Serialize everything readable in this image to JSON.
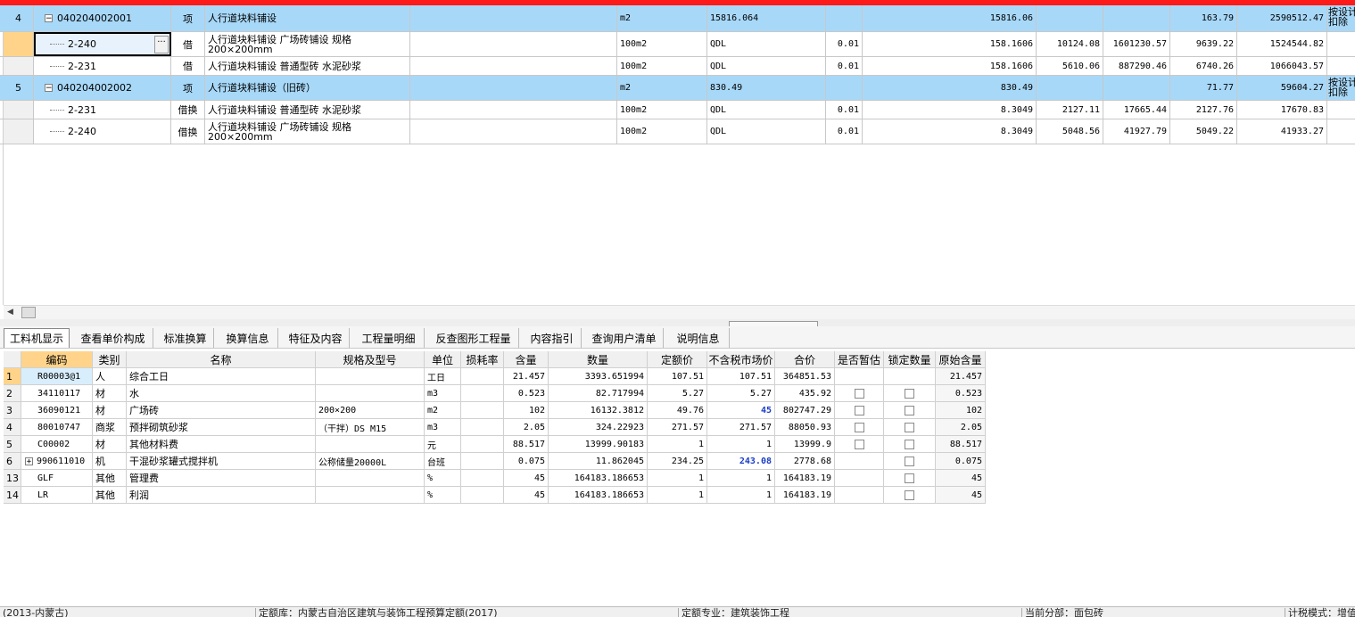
{
  "top_grid": {
    "rows": [
      {
        "num": "4",
        "code": "040204002001",
        "type": "项",
        "name": "人行道块料铺设",
        "unit": "m2",
        "qty_expr": "15816.064",
        "coef": "",
        "qty": "15816.06",
        "c1": "",
        "c2": "",
        "price": "163.79",
        "total": "2590512.47",
        "note": "按设计\n扣除"
      },
      {
        "num": "",
        "code": "2-240",
        "type": "借",
        "name": "人行道块料铺设 广场砖铺设 规格200×200mm",
        "unit": "100m2",
        "qty_expr": "QDL",
        "coef": "0.01",
        "qty": "158.1606",
        "c1": "10124.08",
        "c2": "1601230.57",
        "price": "9639.22",
        "total": "1524544.82",
        "note": ""
      },
      {
        "num": "",
        "code": "2-231",
        "type": "借",
        "name": "人行道块料铺设 普通型砖 水泥砂浆",
        "unit": "100m2",
        "qty_expr": "QDL",
        "coef": "0.01",
        "qty": "158.1606",
        "c1": "5610.06",
        "c2": "887290.46",
        "price": "6740.26",
        "total": "1066043.57",
        "note": ""
      },
      {
        "num": "5",
        "code": "040204002002",
        "type": "项",
        "name": "人行道块料铺设（旧砖）",
        "unit": "m2",
        "qty_expr": "830.49",
        "coef": "",
        "qty": "830.49",
        "c1": "",
        "c2": "",
        "price": "71.77",
        "total": "59604.27",
        "note": "按设计\n扣除"
      },
      {
        "num": "",
        "code": "2-231",
        "type": "借换",
        "name": "人行道块料铺设 普通型砖 水泥砂浆",
        "unit": "100m2",
        "qty_expr": "QDL",
        "coef": "0.01",
        "qty": "8.3049",
        "c1": "2127.11",
        "c2": "17665.44",
        "price": "2127.76",
        "total": "17670.83",
        "note": ""
      },
      {
        "num": "",
        "code": "2-240",
        "type": "借换",
        "name": "人行道块料铺设 广场砖铺设 规格200×200mm",
        "unit": "100m2",
        "qty_expr": "QDL",
        "coef": "0.01",
        "qty": "8.3049",
        "c1": "5048.56",
        "c2": "41927.79",
        "price": "5049.22",
        "total": "41933.27",
        "note": ""
      }
    ]
  },
  "tabs": [
    "工料机显示",
    "查看单价构成",
    "标准换算",
    "换算信息",
    "特征及内容",
    "工程量明细",
    "反查图形工程量",
    "内容指引",
    "查询用户清单",
    "说明信息"
  ],
  "lower_grid": {
    "headers": [
      "编码",
      "类别",
      "名称",
      "规格及型号",
      "单位",
      "损耗率",
      "含量",
      "数量",
      "定额价",
      "不含税市场价",
      "合价",
      "是否暂估",
      "锁定数量",
      "原始含量"
    ],
    "rows": [
      {
        "rn": "1",
        "code": "R00003@1",
        "cat": "人",
        "name": "综合工日",
        "spec": "",
        "unit": "工日",
        "loss": "",
        "content": "21.457",
        "qty": "3393.651994",
        "base": "107.51",
        "market": "107.51",
        "total": "364851.53",
        "est": false,
        "lock": false,
        "orig": "21.457",
        "blue": false,
        "plus": false
      },
      {
        "rn": "2",
        "code": "34110117",
        "cat": "材",
        "name": "水",
        "spec": "",
        "unit": "m3",
        "loss": "",
        "content": "0.523",
        "qty": "82.717994",
        "base": "5.27",
        "market": "5.27",
        "total": "435.92",
        "est": true,
        "lock": true,
        "orig": "0.523",
        "blue": false,
        "plus": false
      },
      {
        "rn": "3",
        "code": "36090121",
        "cat": "材",
        "name": "广场砖",
        "spec": "200×200",
        "unit": "m2",
        "loss": "",
        "content": "102",
        "qty": "16132.3812",
        "base": "49.76",
        "market": "45",
        "total": "802747.29",
        "est": true,
        "lock": true,
        "orig": "102",
        "blue": true,
        "plus": false
      },
      {
        "rn": "4",
        "code": "80010747",
        "cat": "商浆",
        "name": "预拌砌筑砂浆",
        "spec": "（干拌）DS M15",
        "unit": "m3",
        "loss": "",
        "content": "2.05",
        "qty": "324.22923",
        "base": "271.57",
        "market": "271.57",
        "total": "88050.93",
        "est": true,
        "lock": true,
        "orig": "2.05",
        "blue": false,
        "plus": false
      },
      {
        "rn": "5",
        "code": "C00002",
        "cat": "材",
        "name": "其他材料费",
        "spec": "",
        "unit": "元",
        "loss": "",
        "content": "88.517",
        "qty": "13999.90183",
        "base": "1",
        "market": "1",
        "total": "13999.9",
        "est": true,
        "lock": true,
        "orig": "88.517",
        "blue": false,
        "plus": false
      },
      {
        "rn": "6",
        "code": "990611010",
        "cat": "机",
        "name": "干混砂浆罐式搅拌机",
        "spec": "公称储量20000L",
        "unit": "台班",
        "loss": "",
        "content": "0.075",
        "qty": "11.862045",
        "base": "234.25",
        "market": "243.08",
        "total": "2778.68",
        "est": false,
        "lock": true,
        "orig": "0.075",
        "blue": true,
        "plus": true
      },
      {
        "rn": "13",
        "code": "GLF",
        "cat": "其他",
        "name": "管理费",
        "spec": "",
        "unit": "%",
        "loss": "",
        "content": "45",
        "qty": "164183.186653",
        "base": "1",
        "market": "1",
        "total": "164183.19",
        "est": false,
        "lock": true,
        "orig": "45",
        "blue": false,
        "plus": false
      },
      {
        "rn": "14",
        "code": "LR",
        "cat": "其他",
        "name": "利润",
        "spec": "",
        "unit": "%",
        "loss": "",
        "content": "45",
        "qty": "164183.186653",
        "base": "1",
        "market": "1",
        "total": "164183.19",
        "est": false,
        "lock": true,
        "orig": "45",
        "blue": false,
        "plus": false
      }
    ]
  },
  "status": {
    "s1": "(2013-内蒙古)",
    "s2": "定额库：内蒙古自治区建筑与装饰工程预算定额(2017)",
    "s3": "定额专业：建筑装饰工程",
    "s4": "当前分部：面包砖",
    "s5": "计税模式：增值"
  }
}
